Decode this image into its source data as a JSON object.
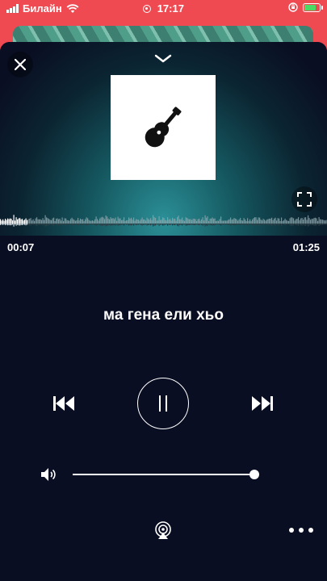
{
  "status_bar": {
    "carrier": "Билайн",
    "time": "17:17",
    "battery_color": "#4cd964",
    "background": "#ef4a52"
  },
  "player": {
    "background": "#0a0e23",
    "artwork_icon": "guitar-icon",
    "time_elapsed": "00:07",
    "time_total": "01:25",
    "progress": 0.082,
    "track_title": "ма гена ели хьо",
    "volume": 1.0,
    "icons": {
      "close": "close-icon",
      "collapse": "chevron-down-icon",
      "fullscreen": "fullscreen-icon",
      "previous": "skip-previous-icon",
      "play_pause": "pause-icon",
      "next": "skip-next-icon",
      "volume": "speaker-icon",
      "airplay": "airplay-icon",
      "more": "more-icon"
    }
  }
}
